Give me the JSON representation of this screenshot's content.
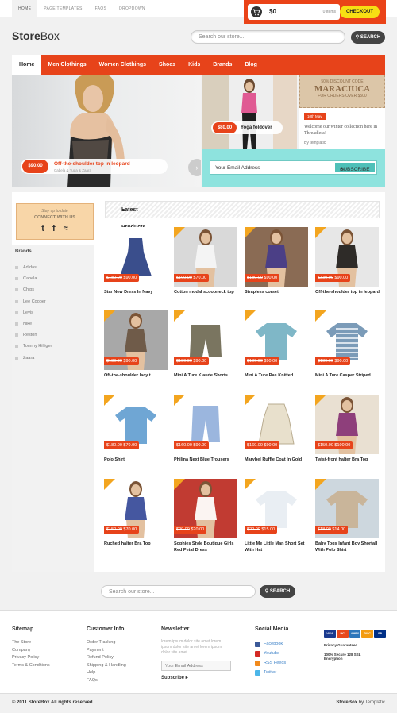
{
  "topnav": {
    "items": [
      "HOME",
      "PAGE TEMPLATES",
      "FAQS",
      "DROPDOWN"
    ]
  },
  "cart": {
    "total": "$0",
    "items": "0 Items",
    "checkout": "CHECKOUT"
  },
  "logo": {
    "part1": "Store",
    "part2": "Box"
  },
  "search": {
    "placeholder": "Search our store...",
    "button": "SEARCH"
  },
  "nav": {
    "items": [
      "Home",
      "Men Clothings",
      "Women Clothings",
      "Shoes",
      "Kids",
      "Brands",
      "Blog"
    ]
  },
  "hero": {
    "price": "$90.00",
    "title": "Off-the-shoulder top in leopard",
    "sub1": "Cabela",
    "sub2": "Tuga",
    "sub3": "Zaara"
  },
  "yoga": {
    "price": "$80.00",
    "title": "Yoga foldover"
  },
  "promo": {
    "line1": "50% DISCOUNT CODE",
    "code": "MARACIUCA",
    "line3": "FOR ORDERS OVER $500"
  },
  "blog": {
    "date": "10th May",
    "text": "Welcome our winter collection here in Threadless!",
    "by": "By templatic"
  },
  "newsletter": {
    "placeholder": "Your Email Address",
    "button": "SUBSCRIBE"
  },
  "connect": {
    "stay": "Stay up to date",
    "title": "CONNECT WITH US"
  },
  "brands": {
    "title": "Brands",
    "items": [
      "Adidas",
      "Cabela",
      "Chips",
      "Lee Cooper",
      "Levis",
      "Nike",
      "Reston",
      "Tommy Hilfiger",
      "Zaara"
    ]
  },
  "latest": {
    "title": "Latest Products"
  },
  "products": [
    {
      "name": "Star New Dress In Navy",
      "old": "$180.00",
      "price": "$90.00",
      "sale": false
    },
    {
      "name": "Cotton modal scoopneck top",
      "old": "$100.00",
      "price": "$70.00",
      "sale": true
    },
    {
      "name": "Strapless corset",
      "old": "$180.00",
      "price": "$90.00",
      "sale": true
    },
    {
      "name": "Off-the-shoulder top in leopard",
      "old": "$330.00",
      "price": "$90.00",
      "sale": true
    },
    {
      "name": "Off-the-shoulder lacy t",
      "old": "$180.00",
      "price": "$90.00",
      "sale": true
    },
    {
      "name": "Mini A Ture Klaude Shorts",
      "old": "$180.00",
      "price": "$90.00",
      "sale": true
    },
    {
      "name": "Mini A Ture Ras Knitted",
      "old": "$180.00",
      "price": "$90.00",
      "sale": true
    },
    {
      "name": "Mini A Ture Casper Striped",
      "old": "$180.00",
      "price": "$90.00",
      "sale": true
    },
    {
      "name": "Polo Shirt",
      "old": "$180.00",
      "price": "$70.00",
      "sale": true
    },
    {
      "name": "Philina Next Blue Trousers",
      "old": "$160.00",
      "price": "$90.00",
      "sale": true
    },
    {
      "name": "Marybel Ruffle Coat In Gold",
      "old": "$160.00",
      "price": "$90.00",
      "sale": true
    },
    {
      "name": "Twist-front halter Bra Top",
      "old": "$150.00",
      "price": "$100.00",
      "sale": true
    },
    {
      "name": "Ruched halter Bra Top",
      "old": "$150.00",
      "price": "$70.00",
      "sale": true
    },
    {
      "name": "Sophies Style Boutique Girls Red Petal Dress",
      "old": "$20.00",
      "price": "$20.00",
      "sale": true
    },
    {
      "name": "Little Me Little Man Short Set With Hat",
      "old": "$20.00",
      "price": "$15.00",
      "sale": true
    },
    {
      "name": "Baby Togs Infant Boy Shortall With Polo Shirt",
      "old": "$18.00",
      "price": "$14.00",
      "sale": true
    }
  ],
  "footer": {
    "sitemap": {
      "title": "Sitemap",
      "links": [
        "The Store",
        "Company",
        "Privacy Policy",
        "Terms & Conditions"
      ]
    },
    "customer": {
      "title": "Customer Info",
      "links": [
        "Order Tracking",
        "Payment",
        "Refund Policy",
        "Shipping & Handling",
        "Help",
        "FAQs"
      ]
    },
    "newsletter": {
      "title": "Newsletter",
      "text": "lorem ipsum dolor site amet lorem ipsum dolor site amet lorem ipsum dolor site amet",
      "placeholder": "Your Email Address",
      "subscribe": "Subscribe"
    },
    "social": {
      "title": "Social Media",
      "links": [
        "Facebook",
        "Youtube",
        "RSS Feeds",
        "Twitter"
      ]
    },
    "payments": {
      "cards": [
        "VISA",
        "MC",
        "AMEX",
        "DISC",
        "PP"
      ],
      "privacy": "Privacy Guaranteed",
      "secure": "100% Secure 128 SSL Encryption"
    }
  },
  "copyright": "© 2011 StoreBox All rights reserved.",
  "credit": {
    "brand": "StoreBox",
    "by": "by",
    "author": "Templatic"
  }
}
